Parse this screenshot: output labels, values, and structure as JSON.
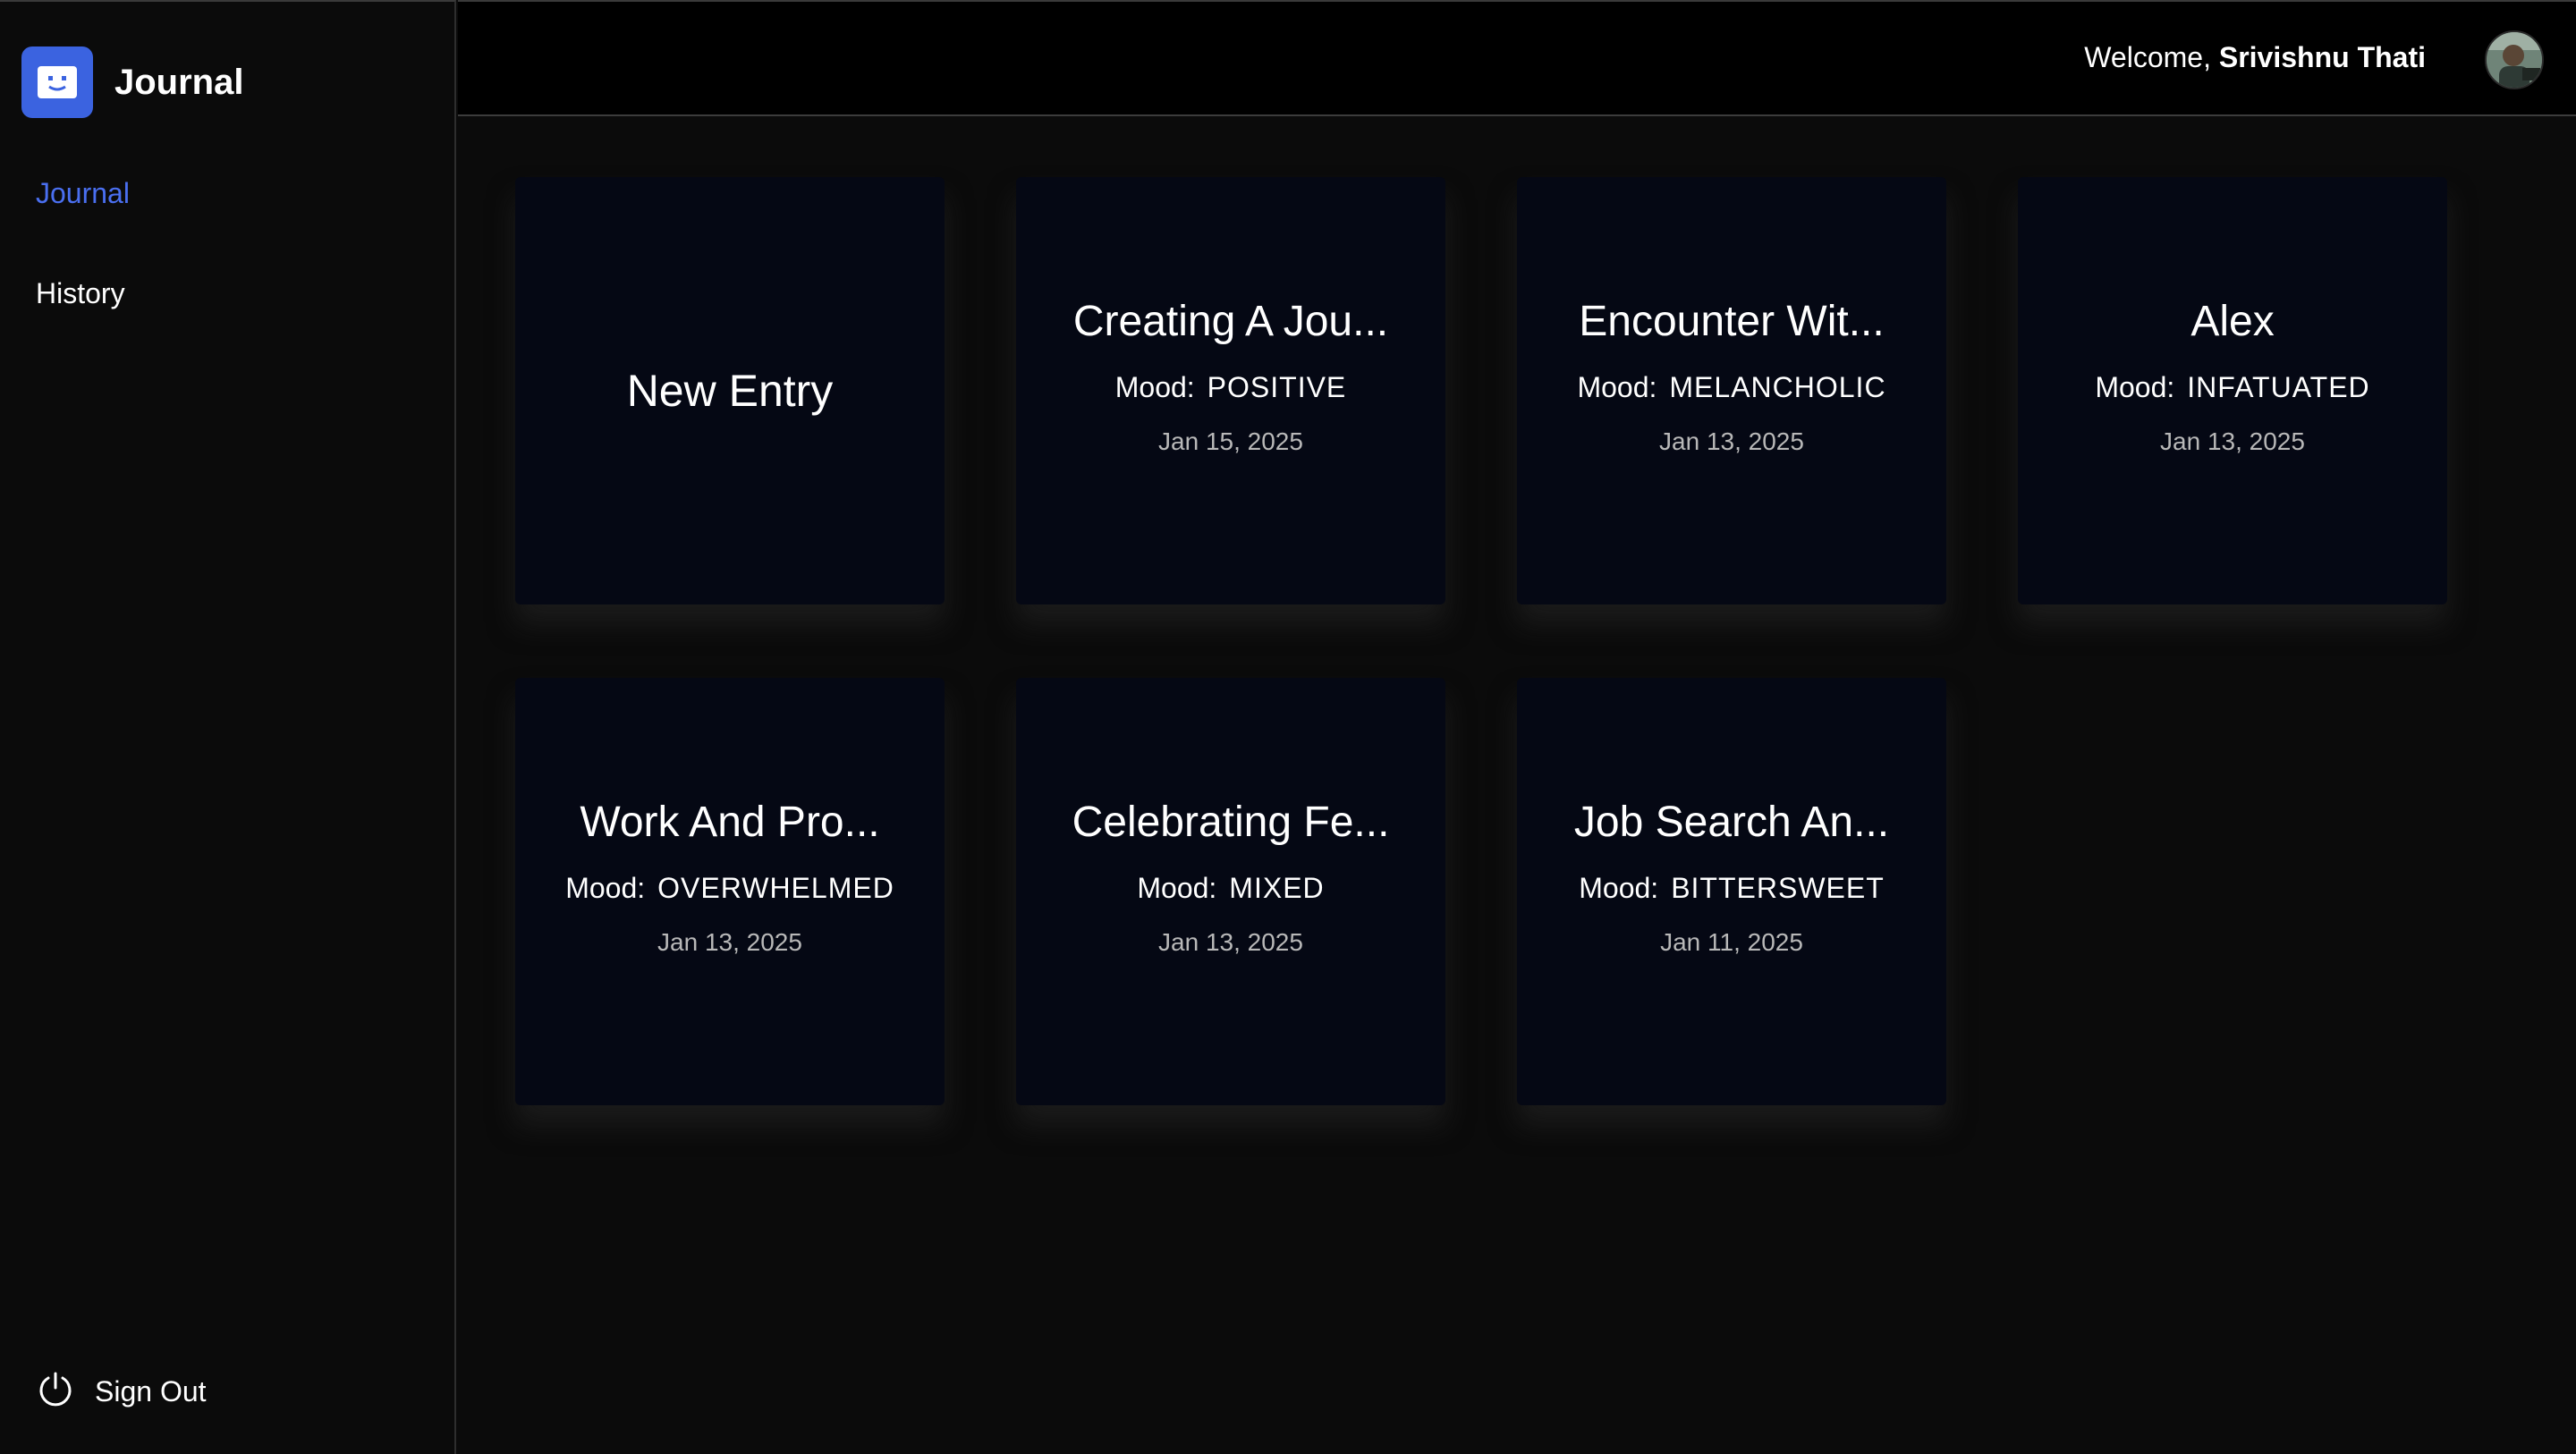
{
  "brand": {
    "title": "Journal",
    "icon": "smiley-icon"
  },
  "nav": {
    "journal": "Journal",
    "history": "History"
  },
  "signout": {
    "label": "Sign Out",
    "icon": "power-icon"
  },
  "header": {
    "welcome_prefix": "Welcome,",
    "user_name": "Srivishnu Thati"
  },
  "colors": {
    "accent": "#3b63e0",
    "active_nav": "#4a6ff0",
    "card_bg": "#050814",
    "page_bg": "#0b0b0b"
  },
  "new_entry": {
    "label": "New Entry"
  },
  "mood_label": "Mood:",
  "entries": [
    {
      "title": "Creating A Jou...",
      "mood": "POSITIVE",
      "date": "Jan 15, 2025"
    },
    {
      "title": "Encounter Wit...",
      "mood": "MELANCHOLIC",
      "date": "Jan 13, 2025"
    },
    {
      "title": "Alex",
      "mood": "INFATUATED",
      "date": "Jan 13, 2025"
    },
    {
      "title": "Work And Pro...",
      "mood": "OVERWHELMED",
      "date": "Jan 13, 2025"
    },
    {
      "title": "Celebrating Fe...",
      "mood": "MIXED",
      "date": "Jan 13, 2025"
    },
    {
      "title": "Job Search An...",
      "mood": "BITTERSWEET",
      "date": "Jan 11, 2025"
    }
  ]
}
